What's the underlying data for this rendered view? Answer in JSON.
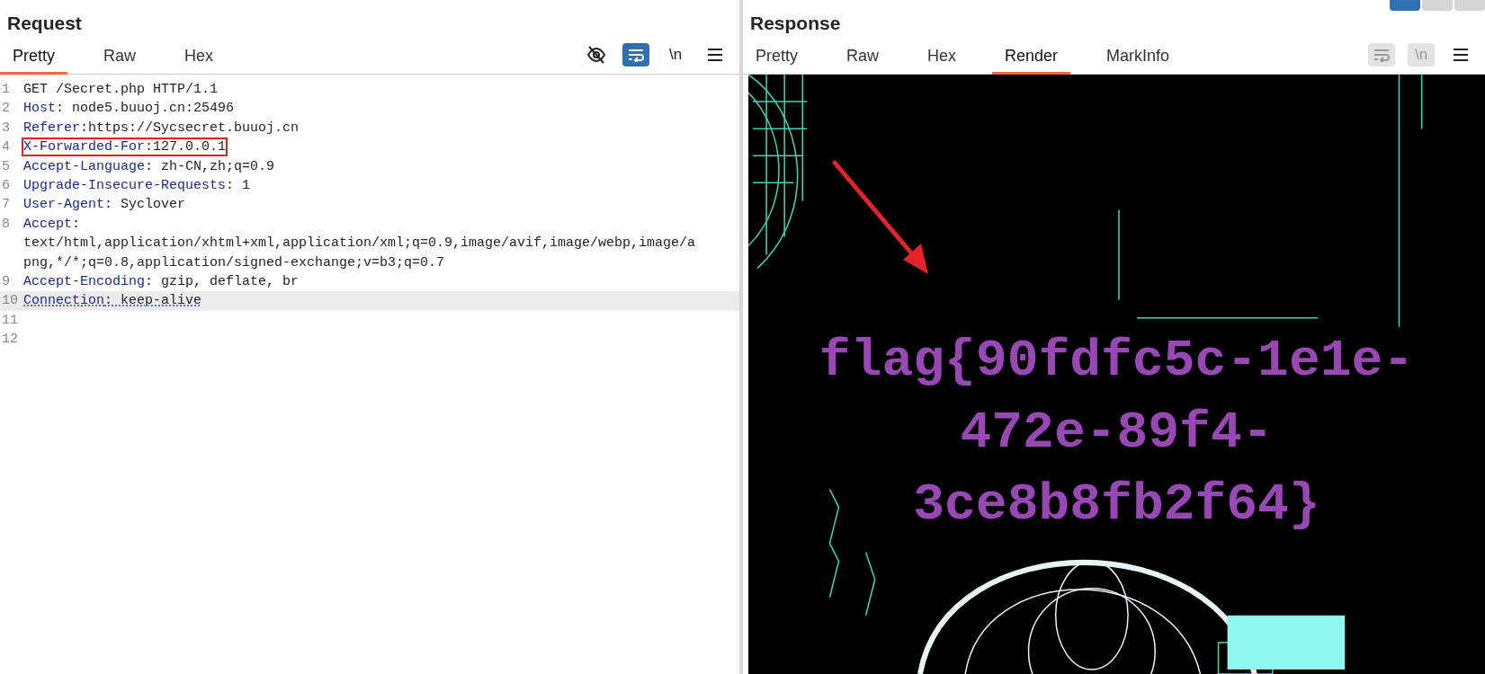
{
  "layout_buttons": [
    {
      "selected": true
    },
    {
      "selected": false
    },
    {
      "selected": false
    }
  ],
  "request": {
    "title": "Request",
    "tabs": [
      {
        "label": "Pretty",
        "selected": true
      },
      {
        "label": "Raw",
        "selected": false
      },
      {
        "label": "Hex",
        "selected": false
      }
    ],
    "toolbar": [
      {
        "kind": "hide",
        "on": false
      },
      {
        "kind": "wrap",
        "on": true
      },
      {
        "kind": "newline",
        "label": "\\n",
        "on": false
      },
      {
        "kind": "menu"
      }
    ],
    "lines": [
      {
        "number": "1",
        "rest": "GET /Secret.php HTTP/1.1",
        "boxed": false,
        "current": false
      },
      {
        "number": "2",
        "name": "Host",
        "rest": ": node5.buuoj.cn:25496",
        "boxed": false,
        "current": false
      },
      {
        "number": "3",
        "name": "Referer",
        "rest": ":https://Sycsecret.buuoj.cn",
        "boxed": false,
        "current": false
      },
      {
        "number": "4",
        "name": "X-Forwarded-For",
        "rest": ":127.0.0.1",
        "boxed": true,
        "current": false
      },
      {
        "number": "5",
        "name": "Accept-Language",
        "rest": ": zh-CN,zh;q=0.9",
        "boxed": false,
        "current": false
      },
      {
        "number": "6",
        "name": "Upgrade-Insecure-Requests",
        "rest": ": 1",
        "boxed": false,
        "current": false
      },
      {
        "number": "7",
        "name": "User-Agent",
        "rest": ": Syclover",
        "boxed": false,
        "current": false
      },
      {
        "number": "8",
        "name": "Accept",
        "rest": ": text/html,application/xhtml+xml,application/xml;q=0.9,image/avif,image/webp,image/apng,*/*;q=0.8,application/signed-exchange;v=b3;q=0.7",
        "boxed": false,
        "current": false
      },
      {
        "number": "9",
        "name": "Accept-Encoding",
        "rest": ": gzip, deflate, br",
        "boxed": false,
        "current": false
      },
      {
        "number": "10",
        "name": "Connection",
        "rest": ": keep-alive",
        "boxed": false,
        "current": true
      },
      {
        "number": "11"
      },
      {
        "number": "12"
      }
    ]
  },
  "response": {
    "title": "Response",
    "tabs": [
      {
        "label": "Pretty",
        "selected": false
      },
      {
        "label": "Raw",
        "selected": false
      },
      {
        "label": "Hex",
        "selected": false
      },
      {
        "label": "Render",
        "selected": true
      },
      {
        "label": "MarkInfo",
        "selected": false
      }
    ],
    "toolbar": [
      {
        "kind": "wrap",
        "on": false
      },
      {
        "kind": "newline",
        "label": "\\n",
        "on": false
      },
      {
        "kind": "menu"
      }
    ],
    "render": {
      "flag_text": "flag{90fdfc5c-1e1e-472e-89f4-3ce8b8fb2f64}"
    }
  }
}
